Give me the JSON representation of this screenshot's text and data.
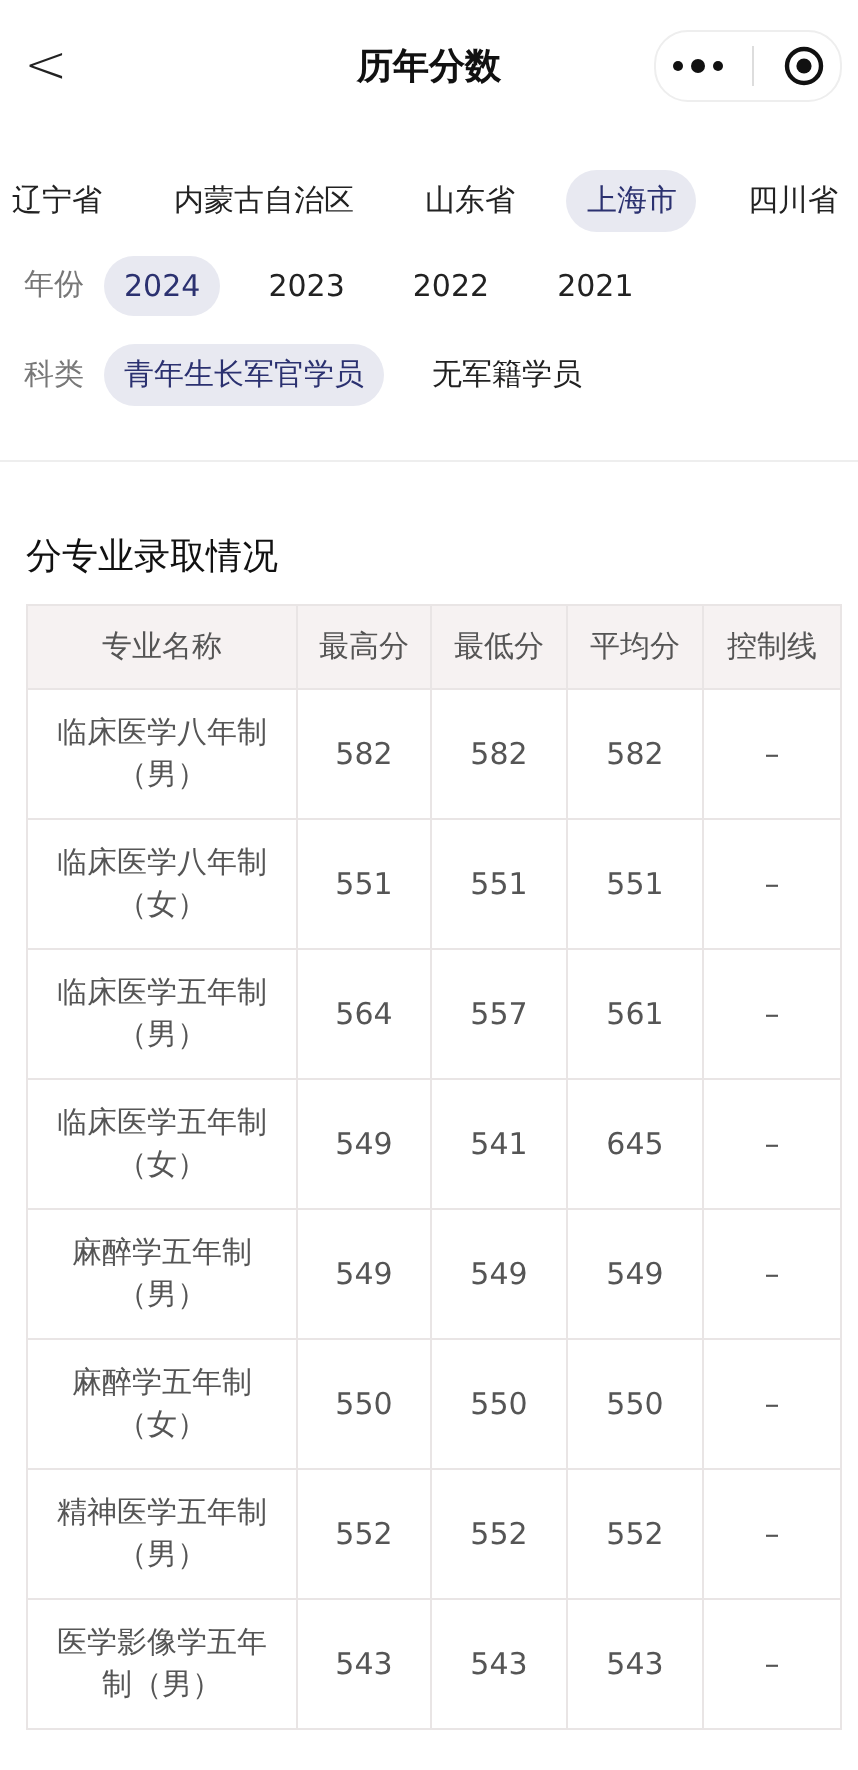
{
  "header": {
    "back": "<",
    "title": "历年分数"
  },
  "provinces": [
    {
      "label": "辽宁省",
      "selected": false
    },
    {
      "label": "内蒙古自治区",
      "selected": false
    },
    {
      "label": "山东省",
      "selected": false
    },
    {
      "label": "上海市",
      "selected": true
    },
    {
      "label": "四川省",
      "selected": false
    }
  ],
  "filters": [
    {
      "label": "年份",
      "options": [
        {
          "label": "2024",
          "selected": true
        },
        {
          "label": "2023",
          "selected": false
        },
        {
          "label": "2022",
          "selected": false
        },
        {
          "label": "2021",
          "selected": false
        }
      ]
    },
    {
      "label": "科类",
      "options": [
        {
          "label": "青年生长军官学员",
          "selected": true
        },
        {
          "label": "无军籍学员",
          "selected": false
        }
      ]
    }
  ],
  "section_title": "分专业录取情况",
  "table": {
    "columns": [
      "专业名称",
      "最高分",
      "最低分",
      "平均分",
      "控制线"
    ],
    "rows": [
      [
        "临床医学八年制（男）",
        "582",
        "582",
        "582",
        "–"
      ],
      [
        "临床医学八年制（女）",
        "551",
        "551",
        "551",
        "–"
      ],
      [
        "临床医学五年制（男）",
        "564",
        "557",
        "561",
        "–"
      ],
      [
        "临床医学五年制（女）",
        "549",
        "541",
        "645",
        "–"
      ],
      [
        "麻醉学五年制（男）",
        "549",
        "549",
        "549",
        "–"
      ],
      [
        "麻醉学五年制（女）",
        "550",
        "550",
        "550",
        "–"
      ],
      [
        "精神医学五年制（男）",
        "552",
        "552",
        "552",
        "–"
      ],
      [
        "医学影像学五年制（男）",
        "543",
        "543",
        "543",
        "–"
      ]
    ]
  }
}
